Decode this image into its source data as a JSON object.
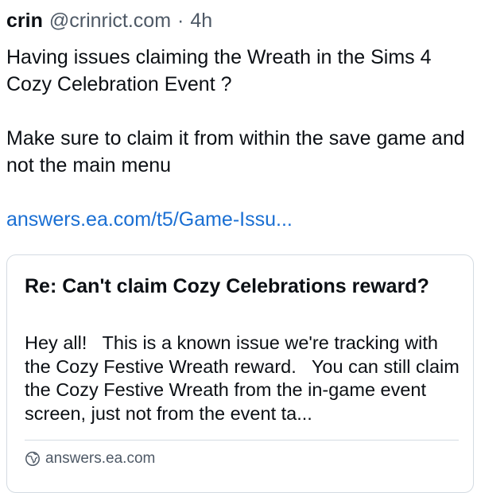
{
  "post": {
    "author_name": "crin",
    "author_handle": "@crinrict.com",
    "separator": "·",
    "timestamp": "4h",
    "paragraphs": [
      "Having issues claiming the Wreath in the Sims 4 Cozy Celebration Event ?",
      "Make sure to claim it from within the save game and not the main menu"
    ],
    "link_text": "answers.ea.com/t5/Game-Issu..."
  },
  "link_card": {
    "title": "Re: Can't claim Cozy Celebrations reward?",
    "description": "Hey all!   This is a known issue we're tracking with the Cozy Festive Wreath reward.   You can still claim the Cozy Festive Wreath from the in-game event screen, just not from the event ta...",
    "source_icon": "globe-icon",
    "source": "answers.ea.com"
  },
  "colors": {
    "text": "#0b0f14",
    "muted": "#4e5966",
    "link": "#1a6fd3",
    "border": "#d4dbe2"
  }
}
